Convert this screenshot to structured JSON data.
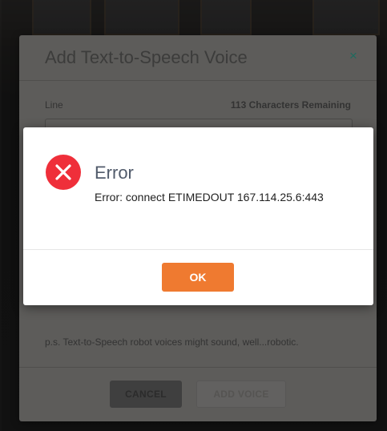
{
  "tts_modal": {
    "title": "Add Text-to-Speech Voice",
    "close_symbol": "×",
    "line_label": "Line",
    "characters_remaining": "113 Characters Remaining",
    "line_value": "",
    "note": "p.s. Text-to-Speech robot voices might sound, well...robotic.",
    "cancel_label": "CANCEL",
    "add_label": "ADD VOICE"
  },
  "error_dialog": {
    "icon": "error-x-icon",
    "title": "Error",
    "message": "Error: connect ETIMEDOUT 167.114.25.6:443",
    "ok_label": "OK"
  },
  "colors": {
    "accent_orange": "#ef7a30",
    "error_red": "#ef2f3a",
    "title_slate": "#515b6b",
    "close_teal": "#1e6b5e"
  }
}
